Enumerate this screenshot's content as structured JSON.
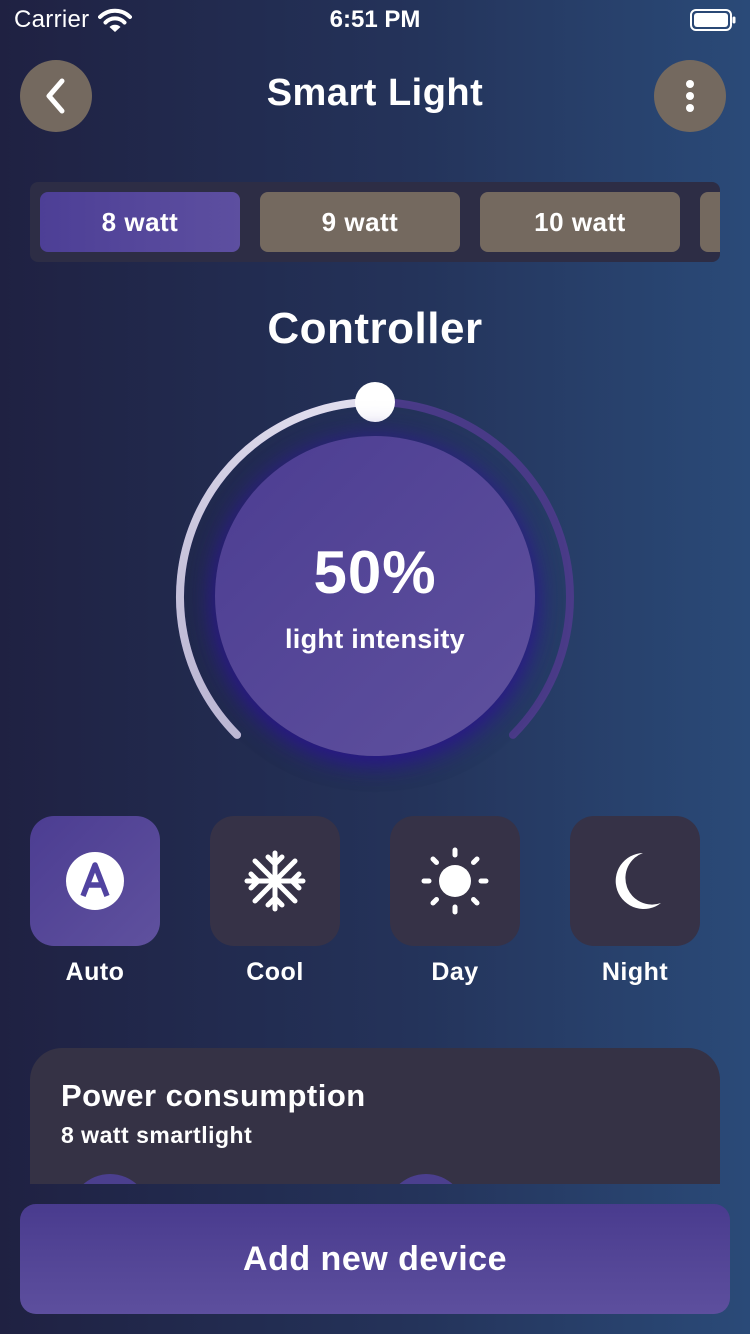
{
  "status_bar": {
    "carrier": "Carrier",
    "time": "6:51 PM"
  },
  "header": {
    "title": "Smart Light",
    "back_icon": "chevron-left-icon",
    "more_icon": "more-vertical-icon"
  },
  "watt_tabs": [
    {
      "label": "8 watt",
      "active": true
    },
    {
      "label": "9 watt",
      "active": false
    },
    {
      "label": "10 watt",
      "active": false
    }
  ],
  "controller": {
    "title": "Controller",
    "intensity": 0.5,
    "intensity_text": "50%",
    "intensity_label": "light intensity"
  },
  "modes": [
    {
      "label": "Auto",
      "icon": "auto-icon",
      "active": true
    },
    {
      "label": "Cool",
      "icon": "snowflake-icon",
      "active": false
    },
    {
      "label": "Day",
      "icon": "sun-icon",
      "active": false
    },
    {
      "label": "Night",
      "icon": "moon-icon",
      "active": false
    }
  ],
  "power": {
    "title": "Power consumption",
    "subtitle": "8 watt smartlight"
  },
  "add_button": {
    "label": "Add new device"
  },
  "colors": {
    "accent": "#5a4a9e",
    "tile": "#363247",
    "header_button": "#74695f"
  }
}
